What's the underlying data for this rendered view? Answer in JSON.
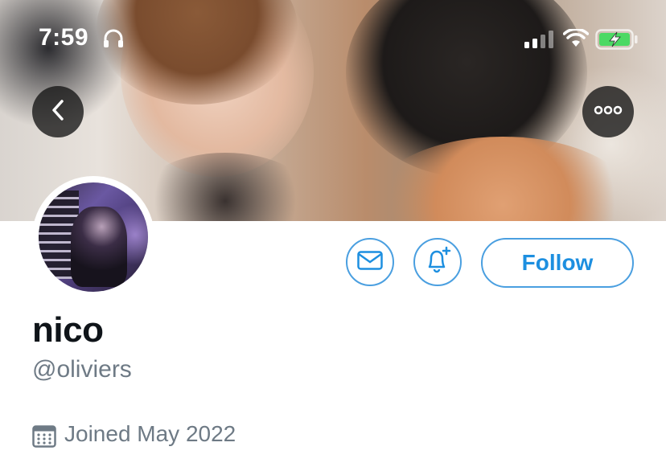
{
  "status_bar": {
    "time": "7:59",
    "headphones_icon": "headphones-icon",
    "signal_icon": "cellular-signal-icon",
    "wifi_icon": "wifi-icon",
    "battery_icon": "battery-charging-icon",
    "battery_color": "#4cd964"
  },
  "header": {
    "back_icon": "chevron-left-icon",
    "more_icon": "more-horizontal-icon"
  },
  "profile": {
    "display_name": "nico",
    "handle": "@oliviers",
    "joined": "Joined May 2022",
    "joined_icon": "calendar-icon"
  },
  "actions": {
    "message_icon": "envelope-icon",
    "notify_icon": "bell-plus-icon",
    "follow_label": "Follow"
  },
  "colors": {
    "accent": "#1d9bf0",
    "text_primary": "#0f1419",
    "text_secondary": "#6e7a85"
  }
}
